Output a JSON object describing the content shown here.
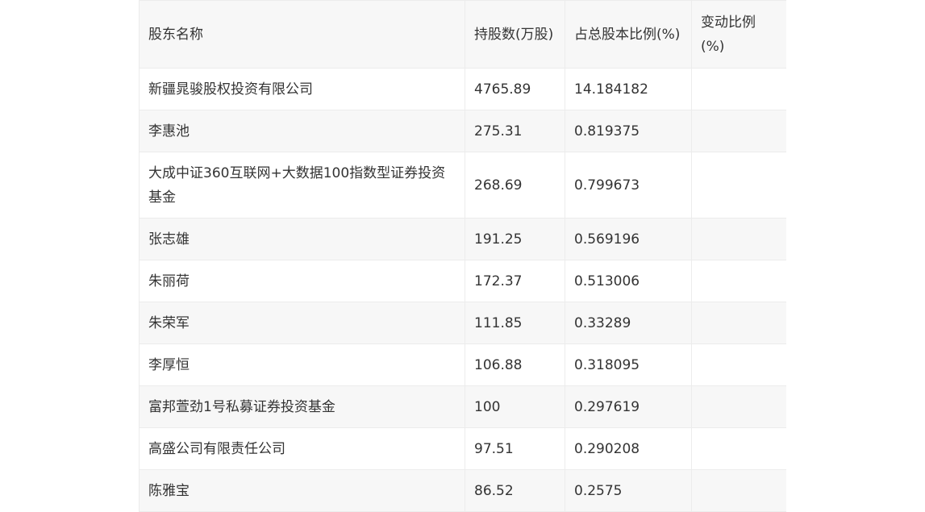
{
  "table": {
    "headers": [
      "股东名称",
      "持股数(万股)",
      "占总股本比例(%)",
      "变动比例(%)"
    ],
    "rows": [
      [
        "新疆晁骏股权投资有限公司",
        "4765.89",
        "14.184182",
        ""
      ],
      [
        "李惠池",
        "275.31",
        "0.819375",
        ""
      ],
      [
        "大成中证360互联网+大数据100指数型证券投资基金",
        "268.69",
        "0.799673",
        ""
      ],
      [
        "张志雄",
        "191.25",
        "0.569196",
        ""
      ],
      [
        "朱丽荷",
        "172.37",
        "0.513006",
        ""
      ],
      [
        "朱荣军",
        "111.85",
        "0.33289",
        ""
      ],
      [
        "李厚恒",
        "106.88",
        "0.318095",
        ""
      ],
      [
        "富邦萱劲1号私募证券投资基金",
        "100",
        "0.297619",
        ""
      ],
      [
        "高盛公司有限责任公司",
        "97.51",
        "0.290208",
        ""
      ],
      [
        "陈雅宝",
        "86.52",
        "0.2575",
        ""
      ]
    ]
  }
}
